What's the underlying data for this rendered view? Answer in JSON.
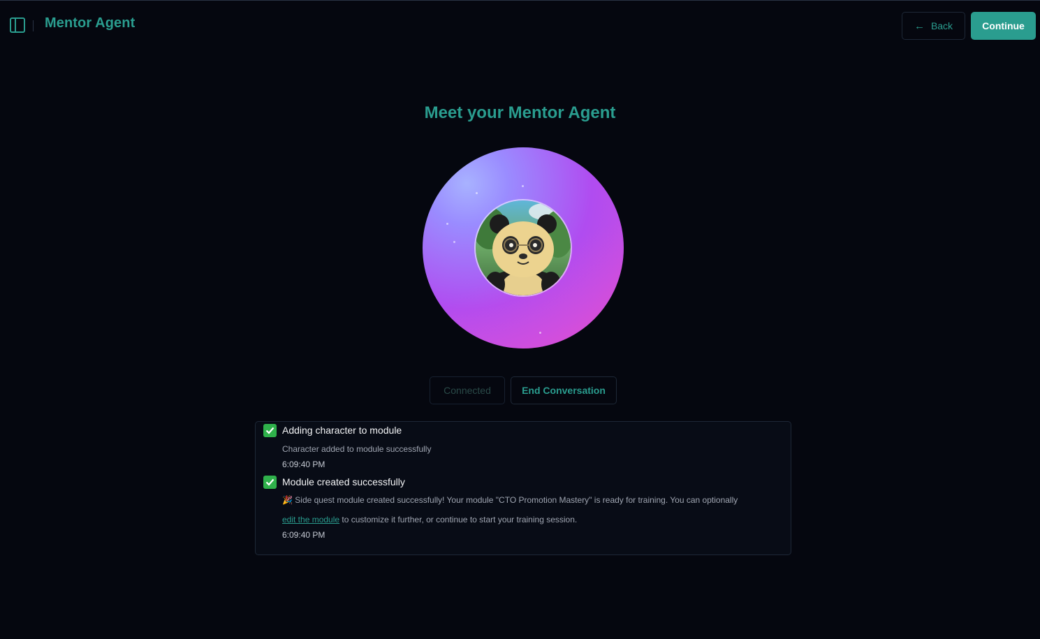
{
  "header": {
    "app_title": "Mentor Agent",
    "back_label": "Back",
    "continue_label": "Continue"
  },
  "main": {
    "title": "Meet your Mentor Agent",
    "status_label": "Connected",
    "end_label": "End Conversation"
  },
  "log": {
    "entries": [
      {
        "title": "Adding character to module",
        "detail": "Character added to module successfully",
        "time": "6:09:40 PM"
      },
      {
        "title": "Module created successfully",
        "detail_line1": "🎉 Side quest module created successfully! Your module \"CTO Promotion Mastery\" is ready for training. You can optionally",
        "detail_link": "edit the module",
        "detail_line2": " to customize it further, or continue to start your training session.",
        "time": "6:09:40 PM"
      }
    ]
  },
  "colors": {
    "accent": "#2a9d8f",
    "background": "#05070f",
    "success": "#2fb14b"
  },
  "icons": [
    "sidebar-toggle-icon",
    "arrow-left-icon",
    "check-icon",
    "party-popper-icon"
  ]
}
